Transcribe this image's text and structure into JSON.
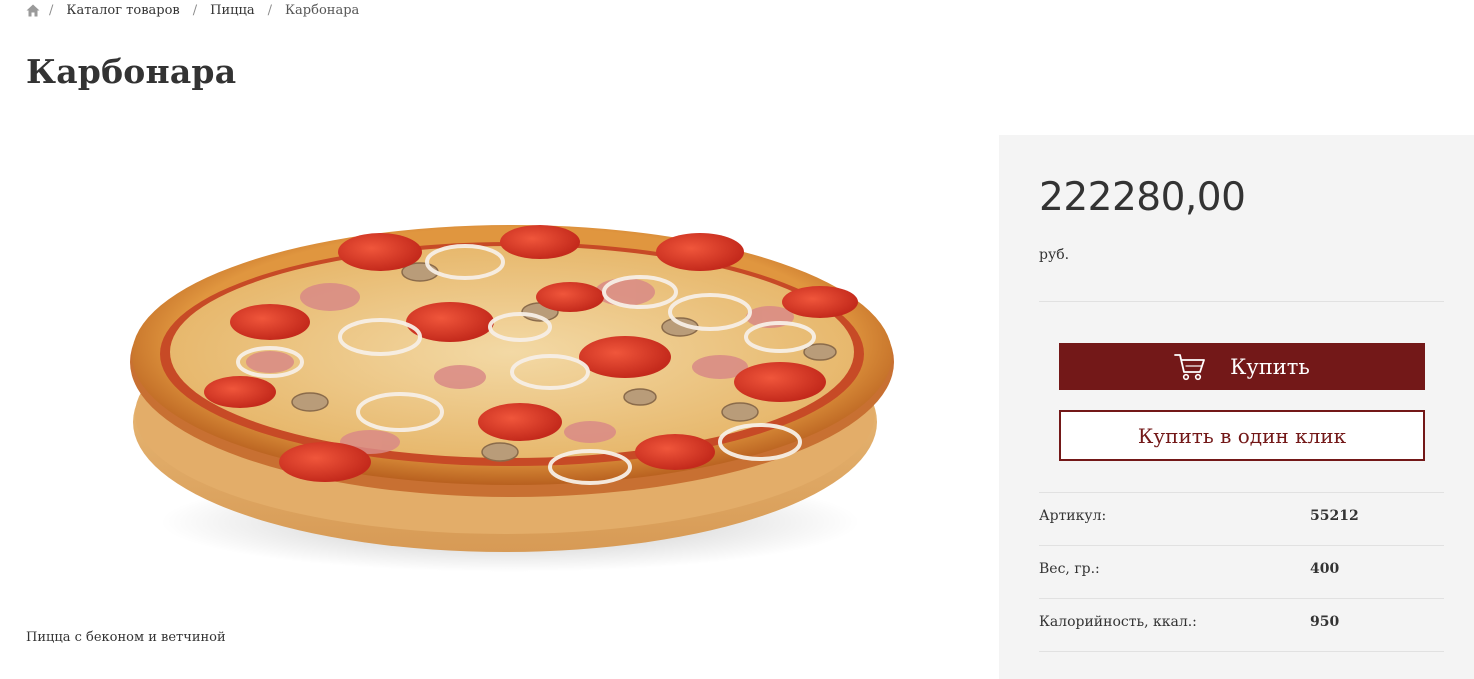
{
  "breadcrumb": {
    "items": [
      "Каталог товаров",
      "Пицца",
      "Карбонара"
    ],
    "separator": "/"
  },
  "product": {
    "title": "Карбонара",
    "description": "Пицца с беконом и ветчиной",
    "image_icon": "pizza-image"
  },
  "purchase": {
    "price": "222280,00",
    "currency": "руб.",
    "buy_label": "Купить",
    "one_click_label": "Купить в один клик",
    "accent_color": "#731818"
  },
  "properties": [
    {
      "label": "Артикул:",
      "value": "55212"
    },
    {
      "label": "Вес, гр.:",
      "value": "400"
    },
    {
      "label": "Калорийность, ккал.:",
      "value": "950"
    }
  ]
}
